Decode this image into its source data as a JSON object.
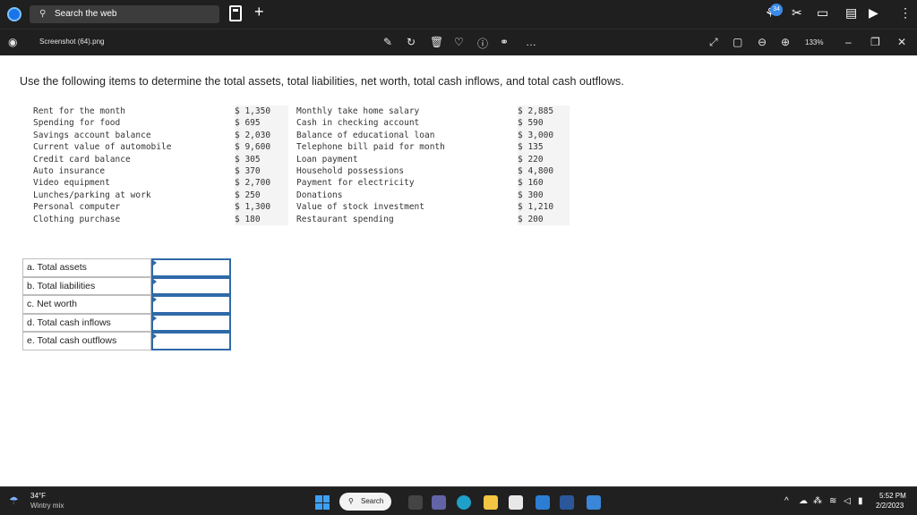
{
  "browser": {
    "search_placeholder": "Search the web",
    "search_icon": "search-icon",
    "new_tab": "+",
    "badge_count": "34"
  },
  "viewer": {
    "file_title": "Screenshot (64).png",
    "zoom": "133%"
  },
  "question": "Use the following items to determine the total assets, total liabilities, net worth, total cash inflows, and total cash outflows.",
  "items_left": [
    {
      "label": "Rent for the month",
      "amount": "$ 1,350"
    },
    {
      "label": "Spending for food",
      "amount": "$ 695"
    },
    {
      "label": "Savings account balance",
      "amount": "$ 2,030"
    },
    {
      "label": "Current value of automobile",
      "amount": "$ 9,600"
    },
    {
      "label": "Credit card balance",
      "amount": "$ 305"
    },
    {
      "label": "Auto insurance",
      "amount": "$ 370"
    },
    {
      "label": "Video equipment",
      "amount": "$ 2,700"
    },
    {
      "label": "Lunches/parking at work",
      "amount": "$ 250"
    },
    {
      "label": "Personal computer",
      "amount": "$ 1,300"
    },
    {
      "label": "Clothing purchase",
      "amount": "$ 180"
    }
  ],
  "items_right": [
    {
      "label": "Monthly take home salary",
      "amount": "$ 2,885"
    },
    {
      "label": "Cash in checking account",
      "amount": "$ 590"
    },
    {
      "label": "Balance of educational loan",
      "amount": "$ 3,000"
    },
    {
      "label": "Telephone bill paid for month",
      "amount": "$ 135"
    },
    {
      "label": "Loan payment",
      "amount": "$ 220"
    },
    {
      "label": "Household possessions",
      "amount": "$ 4,800"
    },
    {
      "label": "Payment for electricity",
      "amount": "$ 160"
    },
    {
      "label": "Donations",
      "amount": "$ 300"
    },
    {
      "label": "Value of stock investment",
      "amount": "$ 1,210"
    },
    {
      "label": "Restaurant spending",
      "amount": "$ 200"
    }
  ],
  "answers": [
    {
      "label": "a. Total assets",
      "value": ""
    },
    {
      "label": "b. Total liabilities",
      "value": ""
    },
    {
      "label": "c. Net worth",
      "value": ""
    },
    {
      "label": "d. Total cash inflows",
      "value": ""
    },
    {
      "label": "e. Total cash outflows",
      "value": ""
    }
  ],
  "taskbar": {
    "temperature": "34°F",
    "weather": "Wintry mix",
    "search_label": "Search",
    "time": "5:52 PM",
    "date": "2/2/2023"
  }
}
